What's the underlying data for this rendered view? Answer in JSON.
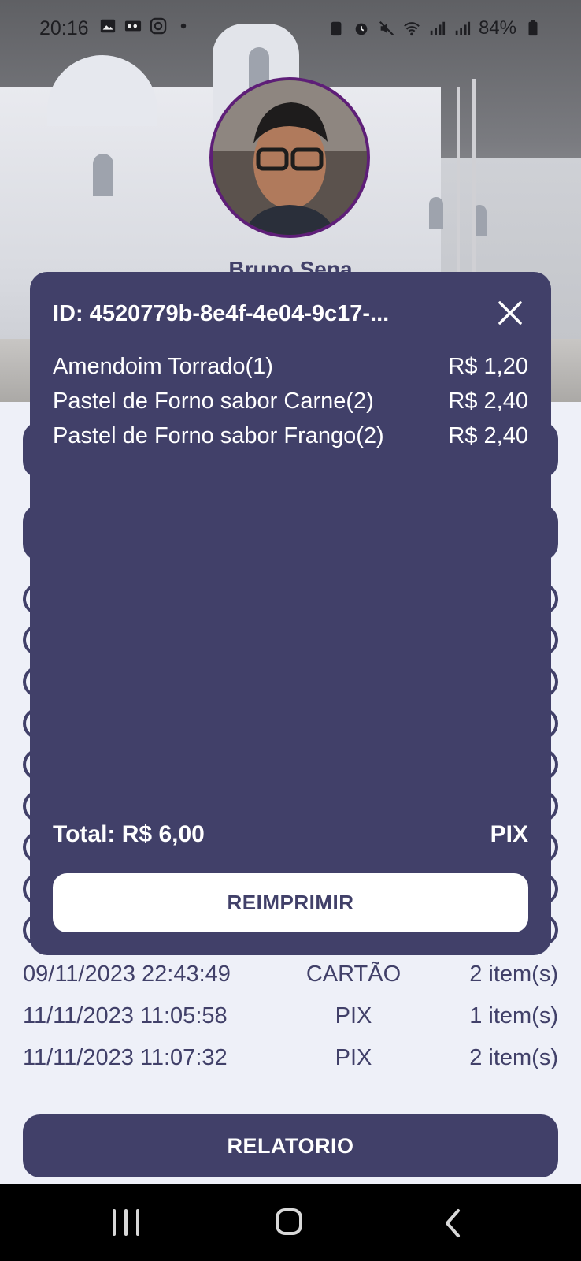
{
  "status_bar": {
    "time": "20:16",
    "battery": "84%",
    "icons": [
      "image-icon",
      "voicemail-icon",
      "instagram-icon",
      "dot-icon",
      "recycle-icon",
      "alarm-icon",
      "mute-icon",
      "wifi-icon",
      "signal-icon",
      "signal-icon",
      "battery-icon"
    ]
  },
  "profile": {
    "name": "Bruno Sena"
  },
  "modal": {
    "id_label": "ID: 4520779b-8e4f-4e04-9c17-...",
    "items": [
      {
        "name": "Amendoim Torrado(1)",
        "price": "R$ 1,20"
      },
      {
        "name": "Pastel de Forno sabor Carne(2)",
        "price": "R$ 2,40"
      },
      {
        "name": "Pastel de Forno sabor Frango(2)",
        "price": "R$ 2,40"
      }
    ],
    "total": "Total: R$ 6,00",
    "payment_method": "PIX",
    "reprint_label": "REIMPRIMIR"
  },
  "sales_list": [
    {
      "date": "09/11/2023 22:43:49",
      "method": "CARTÃO",
      "count": "2 item(s)"
    },
    {
      "date": "11/11/2023 11:05:58",
      "method": "PIX",
      "count": "1 item(s)"
    },
    {
      "date": "11/11/2023 11:07:32",
      "method": "PIX",
      "count": "2 item(s)"
    }
  ],
  "report_button": "RELATORIO",
  "colors": {
    "primary": "#414069",
    "background": "#eef0f8",
    "avatar_border": "#5e1e78"
  }
}
